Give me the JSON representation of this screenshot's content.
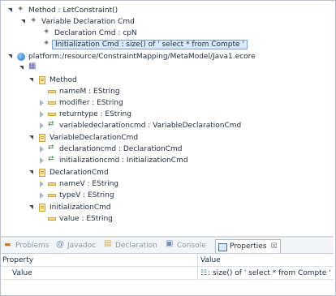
{
  "tree": [
    {
      "label": "Method : LetConstraint()",
      "icon": "diamond-icon",
      "twisty": "open"
    },
    {
      "label": "Variable Declaration Cmd",
      "icon": "diamond-icon",
      "twisty": "open"
    },
    {
      "label": "Declaration Cmd : cpN",
      "icon": "diamond-icon",
      "twisty": "none"
    },
    {
      "label": "Initialization Cmd : size() of  ' select * from Compte '",
      "icon": "diamond-icon",
      "twisty": "none",
      "selected": true
    },
    {
      "label": "platform:/resource/ConstraintMapping/MetaModel/Java1.ecore",
      "icon": "resource-icon",
      "twisty": "open"
    },
    {
      "label": "",
      "icon": "package-icon",
      "twisty": "open"
    },
    {
      "label": "Method",
      "icon": "eclass-icon",
      "twisty": "open"
    },
    {
      "label": "nameM : EString",
      "icon": "eattribute-icon",
      "twisty": "none"
    },
    {
      "label": "modifier : EString",
      "icon": "eattribute-icon",
      "twisty": "closed"
    },
    {
      "label": "returntype : EString",
      "icon": "eattribute-icon",
      "twisty": "closed"
    },
    {
      "label": "variabledeclarationcmd : VariableDeclarationCmd",
      "icon": "ereference-icon",
      "twisty": "closed"
    },
    {
      "label": "VariableDeclarationCmd",
      "icon": "eclass-icon",
      "twisty": "open"
    },
    {
      "label": "declarationcmd : DeclarationCmd",
      "icon": "ereference-icon",
      "twisty": "closed"
    },
    {
      "label": "initializationcmd : InitializationCmd",
      "icon": "ereference-icon",
      "twisty": "closed"
    },
    {
      "label": "DeclarationCmd",
      "icon": "eclass-icon",
      "twisty": "open"
    },
    {
      "label": "nameV : EString",
      "icon": "eattribute-icon",
      "twisty": "closed"
    },
    {
      "label": "typeV : EString",
      "icon": "eattribute-icon",
      "twisty": "closed"
    },
    {
      "label": "InitializationCmd",
      "icon": "eclass-icon",
      "twisty": "open"
    },
    {
      "label": "value : EString",
      "icon": "eattribute-icon",
      "twisty": "none"
    }
  ],
  "tabs": [
    {
      "label": "Problems",
      "icon": "problems-icon"
    },
    {
      "label": "Javadoc",
      "icon": "javadoc-icon"
    },
    {
      "label": "Declaration",
      "icon": "declaration-icon"
    },
    {
      "label": "Console",
      "icon": "console-icon"
    },
    {
      "label": "Properties",
      "icon": "properties-icon",
      "active": true
    }
  ],
  "tab_close": "☒",
  "properties": {
    "col_property": "Property",
    "col_value": "Value",
    "rows": [
      {
        "property": "Value",
        "value": ": size() of  ' select * from Compte '"
      }
    ]
  },
  "colors": {
    "selection": "#d9e9fb",
    "selection_border": "#7da2ce"
  }
}
